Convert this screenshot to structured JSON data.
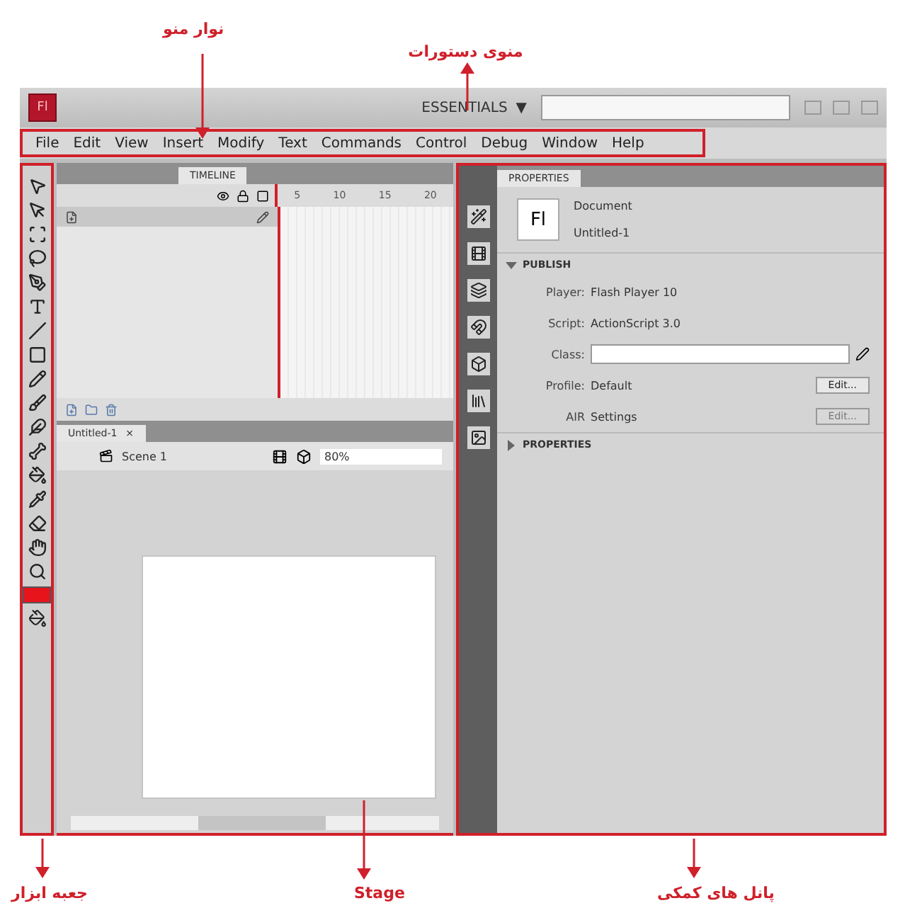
{
  "annotations": [
    {
      "text": "نوار منو"
    },
    {
      "text": "منوی دستورات"
    },
    {
      "text": "پانل های کمکی"
    },
    {
      "text": "Stage"
    },
    {
      "text": "جعبه ابزار"
    }
  ],
  "title_bar": {
    "app_badge": "Fl",
    "workspace": "ESSENTIALS",
    "workspace_caret": "▼"
  },
  "menu_bar": [
    "File",
    "Edit",
    "View",
    "Insert",
    "Modify",
    "Text",
    "Commands",
    "Control",
    "Debug",
    "Window",
    "Help"
  ],
  "timeline": {
    "tab": "TIMELINE",
    "frame_numbers": [
      "5",
      "10",
      "15",
      "20"
    ]
  },
  "document": {
    "tab": "Untitled-1",
    "close": "×",
    "scene": "Scene 1",
    "zoom": "80%"
  },
  "properties": {
    "tab": "PROPERTIES",
    "badge": "Fl",
    "doc_kind": "Document",
    "doc_name": "Untitled-1",
    "sections": [
      {
        "title": "PUBLISH",
        "expanded": true
      },
      {
        "title": "PROPERTIES",
        "expanded": false
      }
    ],
    "rows": [
      {
        "kind": "text",
        "label": "Player:",
        "value": "Flash Player 10"
      },
      {
        "kind": "text",
        "label": "Script:",
        "value": "ActionScript 3.0"
      },
      {
        "kind": "field",
        "label": "Class:"
      },
      {
        "kind": "button",
        "label": "Profile:",
        "value": "Default",
        "button": "Edit...",
        "disabled": false
      },
      {
        "kind": "button",
        "label": "AIR",
        "value": "Settings",
        "button": "Edit...",
        "disabled": true
      }
    ]
  }
}
